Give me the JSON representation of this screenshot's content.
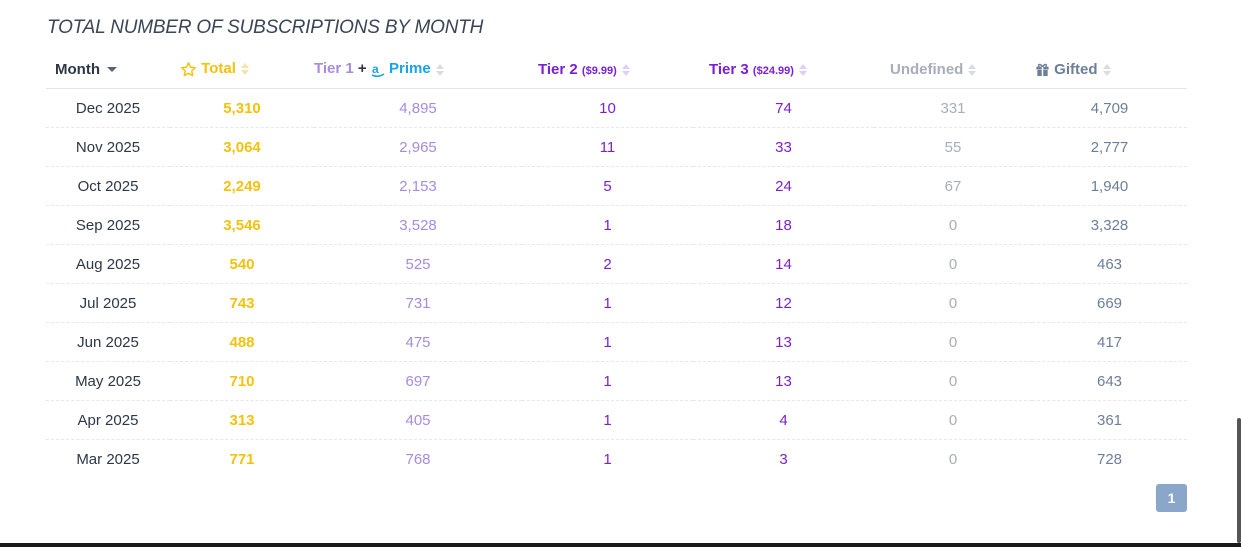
{
  "title": "TOTAL NUMBER OF SUBSCRIPTIONS BY MONTH",
  "headers": {
    "month": "Month",
    "total": "Total",
    "tier1": "Tier 1",
    "plus": "+",
    "prime": "Prime",
    "tier2": "Tier 2",
    "tier2_price": "($9.99)",
    "tier3": "Tier 3",
    "tier3_price": "($24.99)",
    "undefined": "Undefined",
    "gifted": "Gifted"
  },
  "rows": [
    {
      "month": "Dec 2025",
      "total": "5,310",
      "tier1": "4,895",
      "tier2": "10",
      "tier3": "74",
      "undefined": "331",
      "gifted": "4,709"
    },
    {
      "month": "Nov 2025",
      "total": "3,064",
      "tier1": "2,965",
      "tier2": "11",
      "tier3": "33",
      "undefined": "55",
      "gifted": "2,777"
    },
    {
      "month": "Oct 2025",
      "total": "2,249",
      "tier1": "2,153",
      "tier2": "5",
      "tier3": "24",
      "undefined": "67",
      "gifted": "1,940"
    },
    {
      "month": "Sep 2025",
      "total": "3,546",
      "tier1": "3,528",
      "tier2": "1",
      "tier3": "18",
      "undefined": "0",
      "gifted": "3,328"
    },
    {
      "month": "Aug 2025",
      "total": "540",
      "tier1": "525",
      "tier2": "2",
      "tier3": "14",
      "undefined": "0",
      "gifted": "463"
    },
    {
      "month": "Jul 2025",
      "total": "743",
      "tier1": "731",
      "tier2": "1",
      "tier3": "12",
      "undefined": "0",
      "gifted": "669"
    },
    {
      "month": "Jun 2025",
      "total": "488",
      "tier1": "475",
      "tier2": "1",
      "tier3": "13",
      "undefined": "0",
      "gifted": "417"
    },
    {
      "month": "May 2025",
      "total": "710",
      "tier1": "697",
      "tier2": "1",
      "tier3": "13",
      "undefined": "0",
      "gifted": "643"
    },
    {
      "month": "Apr 2025",
      "total": "313",
      "tier1": "405",
      "tier2": "1",
      "tier3": "4",
      "undefined": "0",
      "gifted": "361"
    },
    {
      "month": "Mar 2025",
      "total": "771",
      "tier1": "768",
      "tier2": "1",
      "tier3": "3",
      "undefined": "0",
      "gifted": "728"
    }
  ],
  "pagination": {
    "current": "1"
  },
  "icons": {
    "total": "star-icon",
    "prime": "amazon-icon",
    "gifted": "gift-icon"
  },
  "colors": {
    "total": "#f4c20d",
    "tier1": "#a78bdf",
    "prime": "#1aa3e8",
    "tier2": "#7a1fd8",
    "tier3": "#7a1fd8",
    "undefined": "#a8aeb8",
    "gifted": "#6b7f99",
    "page_button": "#8aa6c8"
  }
}
